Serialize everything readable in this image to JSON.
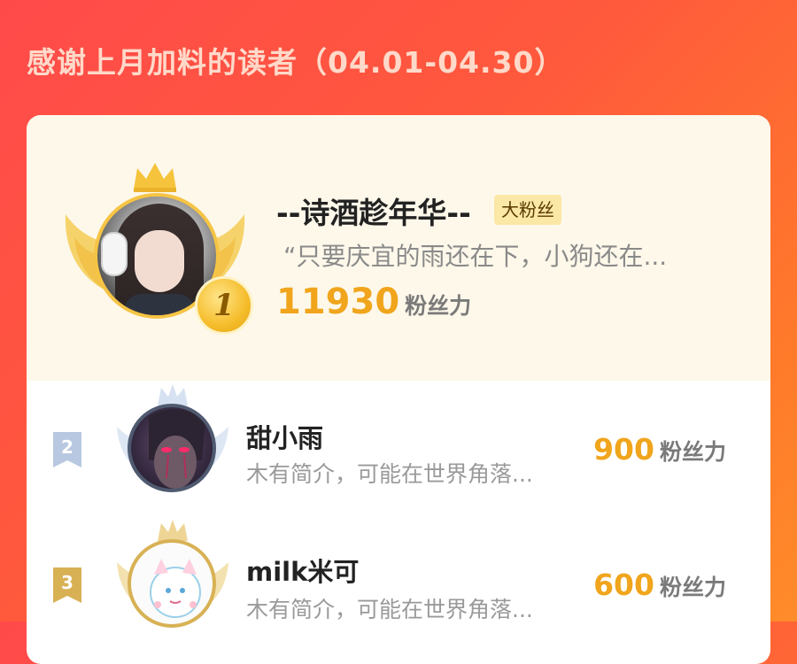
{
  "header": {
    "title": "感谢上月加料的读者（04.01-04.30）"
  },
  "top_reader": {
    "rank": "1",
    "name": "--诗酒趁年华--",
    "badge": "大粉丝",
    "intro": "“只要庆宜的雨还在下，小狗还在...",
    "score": "11930",
    "score_unit": "粉丝力"
  },
  "readers": [
    {
      "rank": "2",
      "name": "甜小雨",
      "intro": "木有简介，可能在世界角落...",
      "score": "900",
      "score_unit": "粉丝力"
    },
    {
      "rank": "3",
      "name": "milk米可",
      "intro": "木有简介，可能在世界角落...",
      "score": "600",
      "score_unit": "粉丝力"
    }
  ],
  "colors": {
    "accent_gold": "#f0a51c",
    "silver": "#b8c8e0",
    "bronze": "#d8b155"
  }
}
